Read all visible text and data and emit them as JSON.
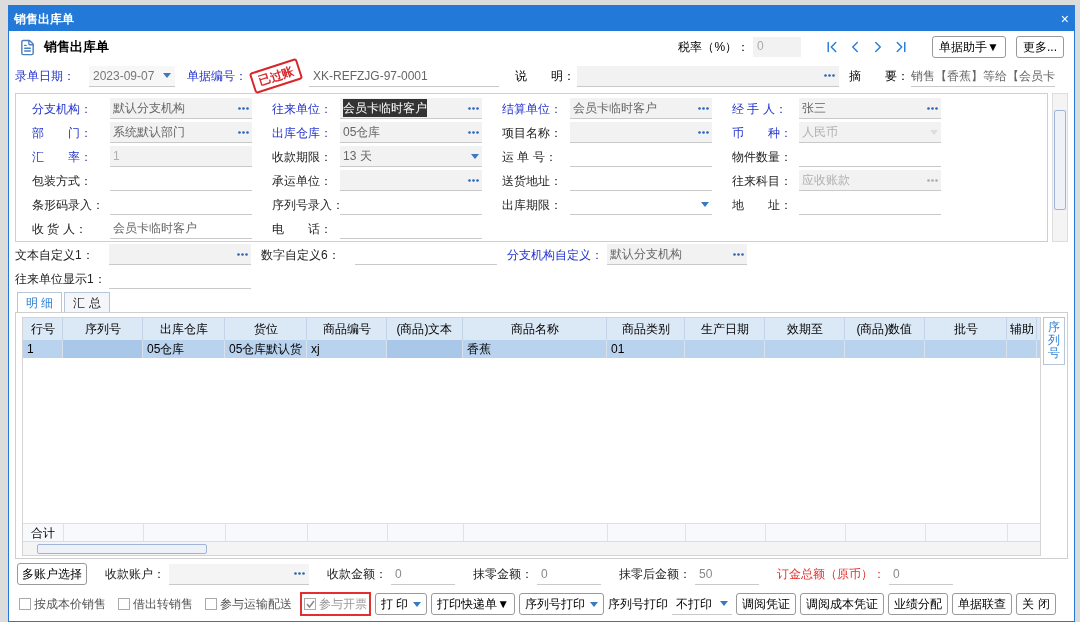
{
  "window": {
    "title": "销售出库单",
    "close": "×"
  },
  "header": {
    "title": "销售出库单",
    "tax_rate": {
      "label": "税率（%）：",
      "value": "0"
    },
    "buttons": [
      "单据助手▼",
      "更多..."
    ]
  },
  "top_fields": {
    "date": {
      "label": "录单日期：",
      "value": "2023-09-07"
    },
    "number": {
      "label": "单据编号：",
      "value": "XK-REFZJG-97-0001"
    },
    "stamp": "已过账",
    "note": {
      "label": "说　　明："
    },
    "summary": {
      "label": "摘　　要：",
      "value": "销售【香蕉】等给【会员卡"
    }
  },
  "form_rows": [
    [
      {
        "label": "分支机构：",
        "value": "默认分支机构",
        "kind": "lookup",
        "blue_label": true,
        "readonly": true
      },
      {
        "label": "往来单位：",
        "value": "会员卡临时客户",
        "kind": "lookup",
        "blue_label": true,
        "readonly": true,
        "value_highlighted": true
      },
      {
        "label": "结算单位：",
        "value": "会员卡临时客户",
        "kind": "lookup",
        "blue_label": true,
        "readonly": true
      },
      {
        "label": "经 手 人：",
        "value": "张三",
        "kind": "lookup",
        "blue_label": true,
        "readonly": true
      }
    ],
    [
      {
        "label": "部　　门：",
        "value": "系统默认部门",
        "kind": "lookup",
        "blue_label": true,
        "readonly": true
      },
      {
        "label": "出库仓库：",
        "value": "05仓库",
        "kind": "lookup",
        "blue_label": true,
        "readonly": true
      },
      {
        "label": "项目名称：",
        "kind": "lookup",
        "blue_label": false,
        "readonly": true
      },
      {
        "label": "币　　种：",
        "value": "人民币",
        "kind": "dropdown",
        "blue_label": true,
        "readonly": true,
        "disabled": true
      }
    ],
    [
      {
        "label": "汇　　率：",
        "value": "1",
        "kind": "text",
        "blue_label": true,
        "readonly": true,
        "disabled": true
      },
      {
        "label": "收款期限：",
        "value": "13 天",
        "kind": "dropdown",
        "blue_label": false,
        "readonly": true
      },
      {
        "label": "运 单 号：",
        "kind": "text",
        "blue_label": false,
        "readonly": false
      },
      {
        "label": "物件数量：",
        "kind": "text",
        "blue_label": false,
        "readonly": false
      }
    ],
    [
      {
        "label": "包装方式：",
        "kind": "text",
        "blue_label": false,
        "readonly": false
      },
      {
        "label": "承运单位：",
        "kind": "lookup",
        "blue_label": false,
        "readonly": true
      },
      {
        "label": "送货地址：",
        "kind": "text",
        "blue_label": false,
        "readonly": false
      },
      {
        "label": "往来科目：",
        "value": "应收账款",
        "kind": "lookup",
        "blue_label": false,
        "readonly": true,
        "disabled": true
      }
    ],
    [
      {
        "label": "条形码录入：",
        "kind": "text",
        "blue_label": false,
        "readonly": false
      },
      {
        "label": "序列号录入：",
        "kind": "text",
        "blue_label": false,
        "readonly": false
      },
      {
        "label": "出库期限：",
        "kind": "dropdown",
        "blue_label": false,
        "readonly": false
      },
      {
        "label": "地　　址：",
        "kind": "text",
        "blue_label": false,
        "readonly": false
      }
    ],
    [
      {
        "label": "收 货 人：",
        "value": "会员卡临时客户",
        "kind": "text",
        "blue_label": false,
        "readonly": false
      },
      {
        "label": "电　　话：",
        "kind": "text",
        "blue_label": false,
        "readonly": false
      }
    ]
  ],
  "custom_rows": [
    [
      {
        "label": "文本自定义1：",
        "kind": "lookup",
        "blue_label": false,
        "readonly": true
      },
      {
        "label": "数字自定义6：",
        "kind": "text",
        "blue_label": false,
        "readonly": false
      },
      {
        "label": "分支机构自定义：",
        "value": "默认分支机构",
        "kind": "lookup",
        "blue_label": true,
        "readonly": true
      }
    ],
    [
      {
        "label": "往来单位显示1：",
        "kind": "text",
        "blue_label": false,
        "readonly": false
      }
    ]
  ],
  "tabs": [
    {
      "label": "明 细",
      "selected": true
    },
    {
      "label": "汇 总",
      "selected": false
    }
  ],
  "side_tab": {
    "label": "序列号"
  },
  "table": {
    "columns": [
      "行号",
      "序列号",
      "出库仓库",
      "货位",
      "商品编号",
      "(商品)文本",
      "商品名称",
      "商品类别",
      "生产日期",
      "效期至",
      "(商品)数值",
      "批号",
      "辅助"
    ],
    "rows": [
      {
        "selected": true,
        "cells": [
          "1",
          "",
          "05仓库",
          "05仓库默认货",
          "xj",
          "",
          "香蕉",
          "01",
          "",
          "",
          "",
          "",
          ""
        ]
      }
    ],
    "total_label": "合计"
  },
  "footer": {
    "account_button": "多账户选择",
    "fields": [
      {
        "label": "收款账户：",
        "kind": "lookup",
        "red_label": false
      },
      {
        "label": "收款金额：",
        "value": "0",
        "kind": "text",
        "red_label": false
      },
      {
        "label": "抹零金额：",
        "value": "0",
        "kind": "text",
        "red_label": false
      },
      {
        "label": "抹零后金额：",
        "value": "50",
        "kind": "text",
        "red_label": false
      },
      {
        "label": "订金总额（原币）：",
        "value": "0",
        "kind": "text",
        "red_label": true
      }
    ],
    "checkboxes": [
      {
        "label": "按成本价销售",
        "checked": false,
        "disabled": false,
        "highlighted": false
      },
      {
        "label": "借出转销售",
        "checked": false,
        "disabled": false,
        "highlighted": false
      },
      {
        "label": "参与运输配送",
        "checked": false,
        "disabled": false,
        "highlighted": false
      },
      {
        "label": "参与开票",
        "checked": true,
        "disabled": true,
        "highlighted": true
      }
    ],
    "controls": [
      {
        "kind": "dropdown_button",
        "label": "打 印"
      },
      {
        "kind": "button",
        "label": "打印快递单▼"
      },
      {
        "kind": "dropdown_button",
        "label": "序列号打印"
      },
      {
        "kind": "label",
        "label": "序列号打印"
      },
      {
        "kind": "select",
        "label": "不打印"
      },
      {
        "kind": "button",
        "label": "调阅凭证"
      },
      {
        "kind": "button",
        "label": "调阅成本凭证"
      },
      {
        "kind": "button",
        "label": "业绩分配"
      },
      {
        "kind": "button",
        "label": "单据联查"
      },
      {
        "kind": "button",
        "label": "关 闭"
      }
    ]
  }
}
